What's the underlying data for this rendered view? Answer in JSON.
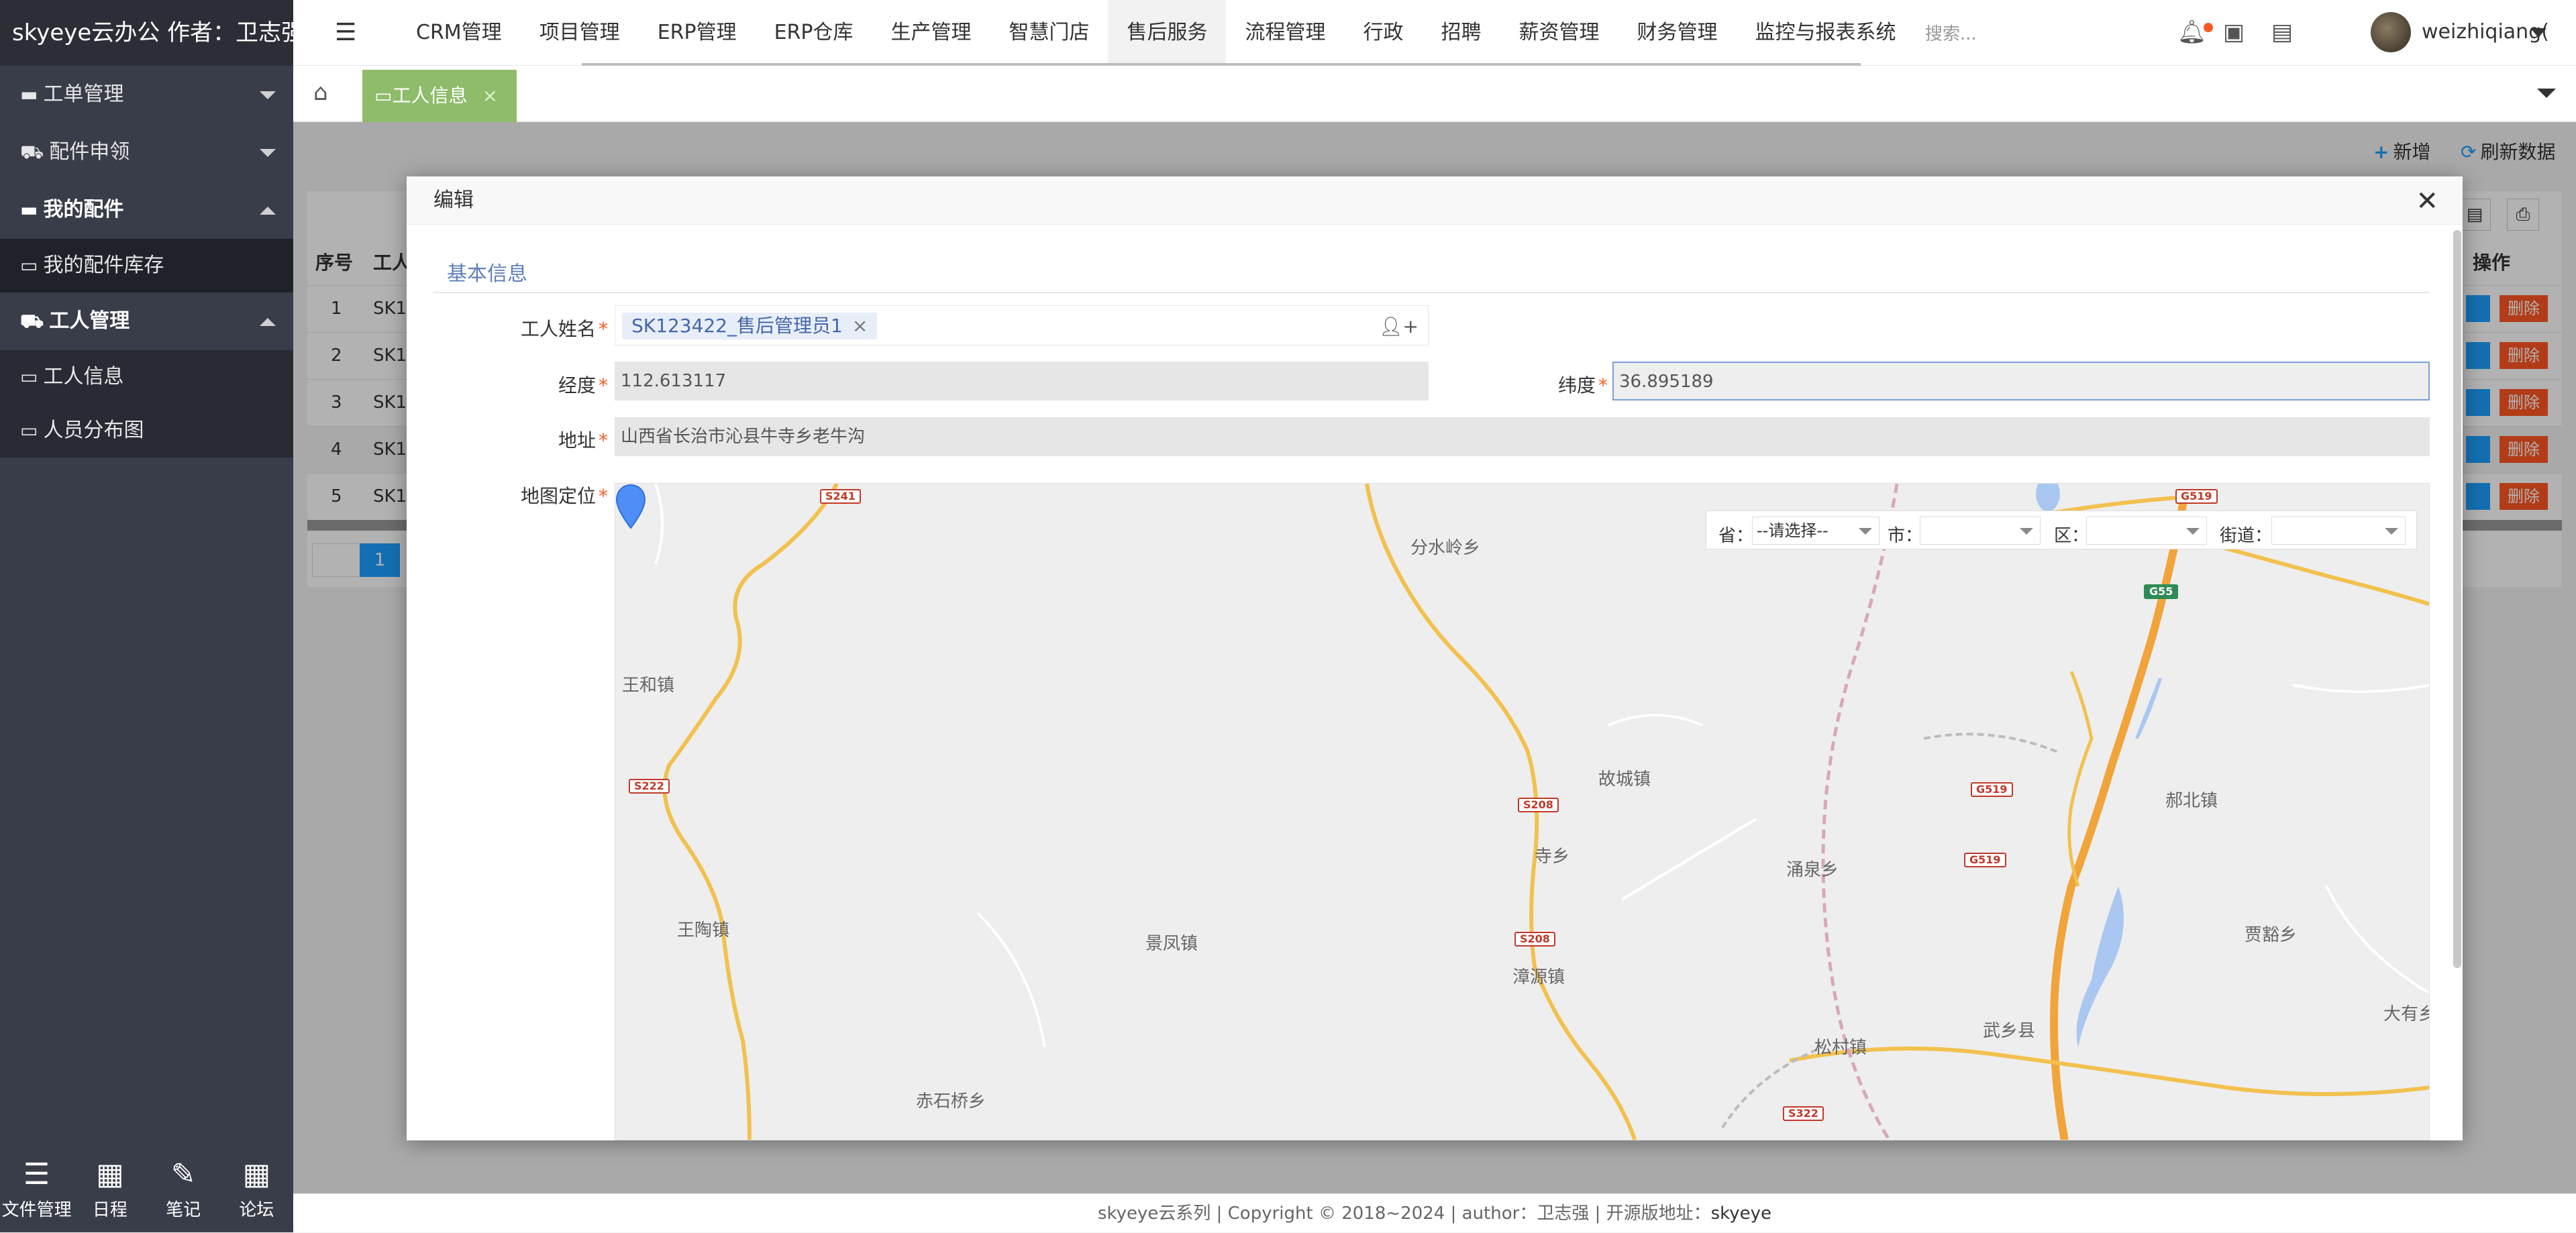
{
  "app": {
    "brand": "skyeye云办公 作者：卫志强"
  },
  "sidebar": {
    "menus": [
      {
        "label": "工单管理",
        "icon": "folder-icon",
        "expanded": false
      },
      {
        "label": "配件申领",
        "icon": "cart-icon",
        "expanded": false
      },
      {
        "label": "我的配件",
        "icon": "folder-icon",
        "expanded": true,
        "children": [
          "我的配件库存"
        ]
      },
      {
        "label": "工人管理",
        "icon": "cart-icon",
        "expanded": true,
        "children": [
          "工人信息",
          "人员分布图"
        ]
      }
    ],
    "bottom": [
      {
        "label": "文件管理",
        "icon": "list-icon"
      },
      {
        "label": "日程",
        "icon": "calendar-icon"
      },
      {
        "label": "笔记",
        "icon": "edit-icon"
      },
      {
        "label": "论坛",
        "icon": "calendar-icon"
      }
    ]
  },
  "topnav": {
    "items": [
      "CRM管理",
      "项目管理",
      "ERP管理",
      "ERP仓库",
      "生产管理",
      "智慧门店",
      "售后服务",
      "流程管理",
      "行政",
      "招聘",
      "薪资管理",
      "财务管理",
      "监控与报表系统"
    ],
    "active": "售后服务",
    "search_placeholder": "搜索...",
    "username": "weizhiqiang(",
    "notification_color": "#ff5722"
  },
  "tabs": {
    "current": "工人信息"
  },
  "background_page": {
    "actions": {
      "add": "新增",
      "refresh": "刷新数据"
    },
    "table": {
      "headers": [
        "序号",
        "工人",
        "操作"
      ],
      "rows": [
        {
          "no": "1",
          "code": "SK1"
        },
        {
          "no": "2",
          "code": "SK1"
        },
        {
          "no": "3",
          "code": "SK1"
        },
        {
          "no": "4",
          "code": "SK1"
        },
        {
          "no": "5",
          "code": "SK1"
        }
      ],
      "delete_label": "删除"
    },
    "pager": {
      "current": "1"
    }
  },
  "modal": {
    "title": "编辑",
    "section": "基本信息",
    "fields": {
      "worker_name": {
        "label": "工人姓名",
        "value": "SK123422_售后管理员1"
      },
      "longitude": {
        "label": "经度",
        "value": "112.613117"
      },
      "latitude": {
        "label": "纬度",
        "value": "36.895189"
      },
      "address": {
        "label": "地址",
        "value": "山西省长治市沁县牛寺乡老牛沟"
      },
      "map": {
        "label": "地图定位"
      }
    },
    "map": {
      "region": {
        "province_label": "省：",
        "province_value": "--请选择--",
        "city_label": "市：",
        "city_value": "",
        "district_label": "区：",
        "district_value": "",
        "street_label": "街道：",
        "street_value": ""
      },
      "places": [
        "分水岭乡",
        "王和镇",
        "故城镇",
        "郝北镇",
        "寺乡",
        "涌泉乡",
        "王陶镇",
        "景凤镇",
        "漳源镇",
        "贾豁乡",
        "武乡县",
        "松村镇",
        "大有乡",
        "赤石桥乡"
      ],
      "roads": [
        "S241",
        "G519",
        "G55",
        "S222",
        "S208",
        "G519",
        "G519",
        "S208",
        "S322"
      ]
    }
  },
  "footer": {
    "text": "skyeye云系列 | Copyright © 2018~2024 | author：卫志强 | 开源版地址：",
    "link": "skyeye"
  }
}
